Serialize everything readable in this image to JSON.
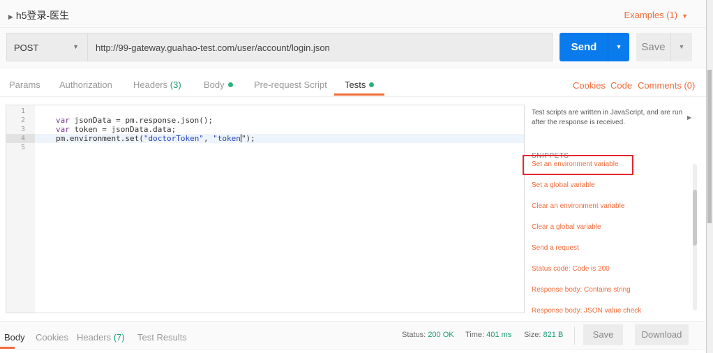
{
  "request": {
    "name": "h5登录-医生",
    "examples": "Examples (1)",
    "method": "POST",
    "url": "http://99-gateway.guahao-test.com/user/account/login.json",
    "send": "Send",
    "save": "Save"
  },
  "tabs": [
    {
      "label": "Params"
    },
    {
      "label": "Authorization"
    },
    {
      "label": "Headers",
      "count": "(3)"
    },
    {
      "label": "Body"
    },
    {
      "label": "Pre-request Script"
    },
    {
      "label": "Tests"
    }
  ],
  "tab_links": [
    "Cookies",
    "Code",
    "Comments (0)"
  ],
  "editor": {
    "line_numbers": [
      "1",
      "2",
      "3",
      "4",
      "5"
    ],
    "lines": [
      [],
      [
        {
          "t": "var",
          "c": "kw"
        },
        {
          "t": " jsonData = pm.response.json();",
          "c": ""
        }
      ],
      [
        {
          "t": "var",
          "c": "kw"
        },
        {
          "t": " token = jsonData.data;",
          "c": ""
        }
      ],
      [
        {
          "t": "pm.environment.set(",
          "c": ""
        },
        {
          "t": "\"doctorToken\"",
          "c": "str"
        },
        {
          "t": ", ",
          "c": ""
        },
        {
          "t": "\"token",
          "c": "str"
        },
        {
          "t": "|",
          "c": "cursor"
        },
        {
          "t": "\");",
          "c": ""
        }
      ],
      []
    ]
  },
  "side": {
    "description": "Test scripts are written in JavaScript, and are run after the response is received.",
    "snippets_title": "SNIPPETS",
    "snippets": [
      "Set an environment variable",
      "Set a global variable",
      "Clear an environment variable",
      "Clear a global variable",
      "Send a request",
      "Status code: Code is 200",
      "Response body: Contains string",
      "Response body: JSON value check"
    ]
  },
  "response": {
    "tabs": [
      {
        "label": "Body"
      },
      {
        "label": "Cookies"
      },
      {
        "label": "Headers",
        "count": "(7)"
      },
      {
        "label": "Test Results"
      }
    ],
    "status_label": "Status:",
    "status": "200 OK",
    "time_label": "Time:",
    "time": "401 ms",
    "size_label": "Size:",
    "size": "821 B",
    "save": "Save",
    "download": "Download"
  },
  "colors": {
    "accent": "#f26b3a",
    "send": "#097bed",
    "success": "#1c9c77",
    "highlight_box": "#e3262d"
  }
}
